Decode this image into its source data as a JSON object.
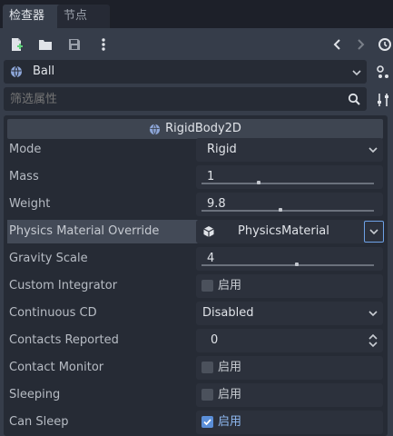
{
  "tabs": [
    {
      "label": "检查器",
      "active": true
    },
    {
      "label": "节点",
      "active": false
    }
  ],
  "toolbar": {
    "icons": [
      "new-resource-icon",
      "open-folder-icon",
      "save-icon",
      "more-vert-icon",
      "back-icon",
      "forward-icon",
      "history-icon"
    ]
  },
  "node": {
    "name": "Ball",
    "icon": "globe-icon"
  },
  "filter": {
    "placeholder": "筛选属性",
    "value": ""
  },
  "section": {
    "title": "RigidBody2D",
    "icon": "globe-icon"
  },
  "properties": [
    {
      "name": "Mode",
      "type": "dropdown",
      "value": "Rigid"
    },
    {
      "name": "Mass",
      "type": "slider",
      "value": "1",
      "fill": 0.33
    },
    {
      "name": "Weight",
      "type": "slider",
      "value": "9.8",
      "fill": 0.46
    },
    {
      "name": "Physics Material Override",
      "type": "resource",
      "value": "PhysicsMaterial",
      "highlighted": true
    },
    {
      "name": "Gravity Scale",
      "type": "slider",
      "value": "4",
      "fill": 0.55
    },
    {
      "name": "Custom Integrator",
      "type": "checkbox",
      "checked": false,
      "value": "启用"
    },
    {
      "name": "Continuous CD",
      "type": "dropdown",
      "value": "Disabled"
    },
    {
      "name": "Contacts Reported",
      "type": "spinbox",
      "value": "0"
    },
    {
      "name": "Contact Monitor",
      "type": "checkbox",
      "checked": false,
      "value": "启用"
    },
    {
      "name": "Sleeping",
      "type": "checkbox",
      "checked": false,
      "value": "启用"
    },
    {
      "name": "Can Sleep",
      "type": "checkbox",
      "checked": true,
      "value": "启用"
    }
  ],
  "colors": {
    "accent": "#5b8fd9",
    "panel": "#363d4a",
    "field": "#2c313c",
    "inspector_bg": "#262b35"
  }
}
